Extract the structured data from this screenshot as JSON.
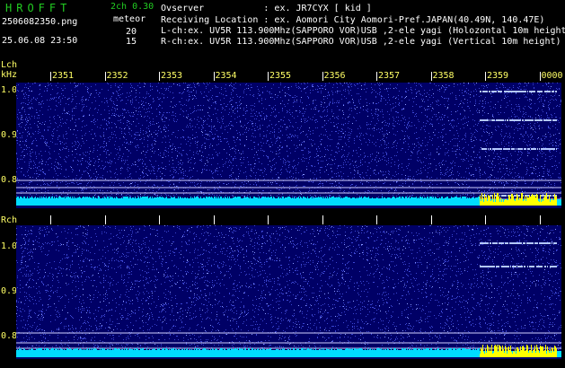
{
  "header": {
    "app_title": "HROFFT",
    "version": "2ch 0.30",
    "filename": "2506082350.png",
    "datetime": "25.06.08 23:50",
    "meteor_label": "meteor",
    "meteor_count_l": "20",
    "meteor_count_r": "15"
  },
  "info": {
    "observer": "Ovserver           : ex. JR7CYX [ kid ]",
    "location": "Receiving Location : ex. Aomori City Aomori-Pref.JAPAN(40.49N, 140.47E)",
    "lch": "L-ch:ex. UV5R 113.900Mhz(SAPPORO VOR)USB ,2-ele yagi (Holozontal 10m height)",
    "rch": "R-ch:ex. UV5R 113.900Mhz(SAPPORO VOR)USB ,2-ele yagi (Vertical 10m height)"
  },
  "lch": {
    "label": "Lch",
    "unit": "kHz",
    "ticks": [
      "1.0",
      "0.9",
      "0.8"
    ]
  },
  "rch": {
    "label": "Rch",
    "ticks": [
      "1.0",
      "0.9",
      "0.8"
    ]
  },
  "time_labels": [
    "2351",
    "2352",
    "2353",
    "2354",
    "2355",
    "2356",
    "2357",
    "2358",
    "2359",
    "0000"
  ],
  "colors": {
    "panel_bg": "#000066",
    "noise": "#3c46d2",
    "baseline": "#00dcff",
    "meteor_bars": "#ffff00",
    "echo_trace": "#b4c8ff",
    "guide_line": "#d0d0ff"
  }
}
